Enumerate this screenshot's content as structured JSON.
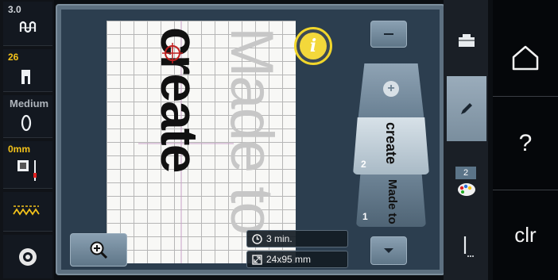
{
  "status_bar": {
    "needle_position": "3.0",
    "stitch_plate": "26",
    "thread_tension": "Medium",
    "needle_depth": "0mm"
  },
  "canvas": {
    "design_text_front": "create",
    "design_text_back": "Made to"
  },
  "info_overlay": {
    "time": "3 min.",
    "size": "24x95 mm"
  },
  "layer_stack": {
    "layer2_number": "2",
    "layer2_text": "create",
    "layer1_number": "1",
    "layer1_text": "Made to"
  },
  "right_panel": {
    "color_count": "2"
  },
  "nav": {
    "help_label": "?",
    "clear_label": "clr"
  },
  "colors": {
    "accent": "#f3c21a",
    "panel": "#5d7080",
    "active_tab": "#8a9eae"
  }
}
